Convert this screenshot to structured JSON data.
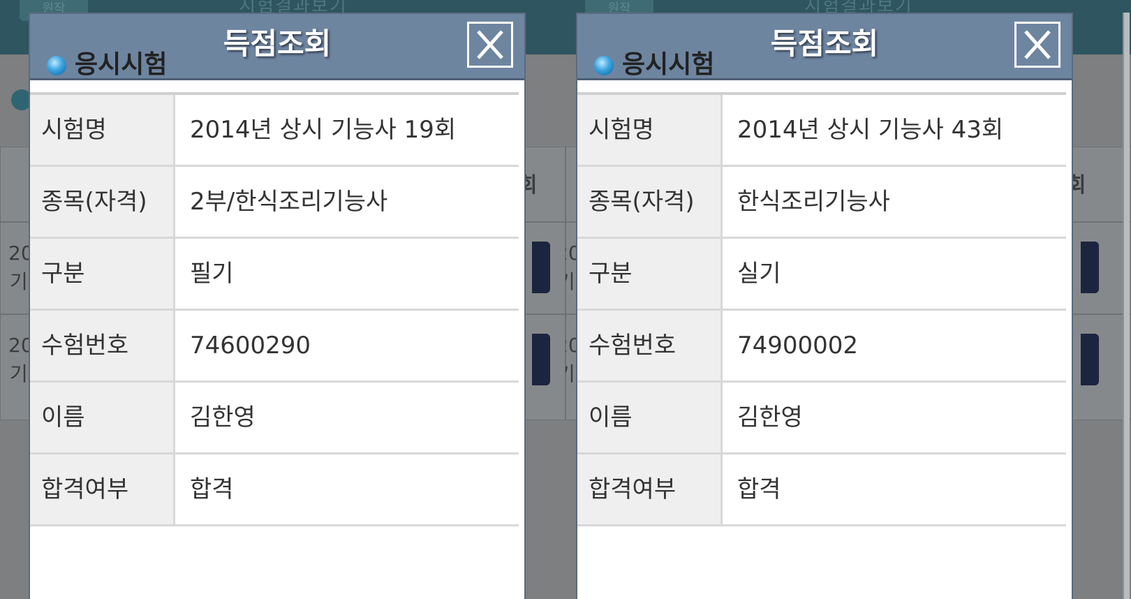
{
  "background": {
    "header_home": "원작",
    "header_title": "시험결과보기",
    "table_header_partial": "회",
    "row_text_partial": [
      "20",
      "기"
    ]
  },
  "panels": [
    {
      "dialog_title": "득점조회",
      "section_title": "응시시험",
      "rows": [
        {
          "label": "시험명",
          "value": "2014년 상시 기능사 19회"
        },
        {
          "label": "종목(자격)",
          "value": "2부/한식조리기능사"
        },
        {
          "label": "구분",
          "value": "필기"
        },
        {
          "label": "수험번호",
          "value": "74600290"
        },
        {
          "label": "이름",
          "value": "김한영"
        },
        {
          "label": "합격여부",
          "value": "합격"
        }
      ]
    },
    {
      "dialog_title": "득점조회",
      "section_title": "응시시험",
      "rows": [
        {
          "label": "시험명",
          "value": "2014년 상시 기능사 43회"
        },
        {
          "label": "종목(자격)",
          "value": "한식조리기능사"
        },
        {
          "label": "구분",
          "value": "실기"
        },
        {
          "label": "수험번호",
          "value": "74900002"
        },
        {
          "label": "이름",
          "value": "김한영"
        },
        {
          "label": "합격여부",
          "value": "합격"
        }
      ]
    }
  ],
  "colors": {
    "modal_header": "#6e85a0",
    "label_bg": "#efefef",
    "overlay": "#7c8083",
    "bullet": "#3aa3e0"
  },
  "icons": [
    "close-icon",
    "bullet-icon"
  ]
}
